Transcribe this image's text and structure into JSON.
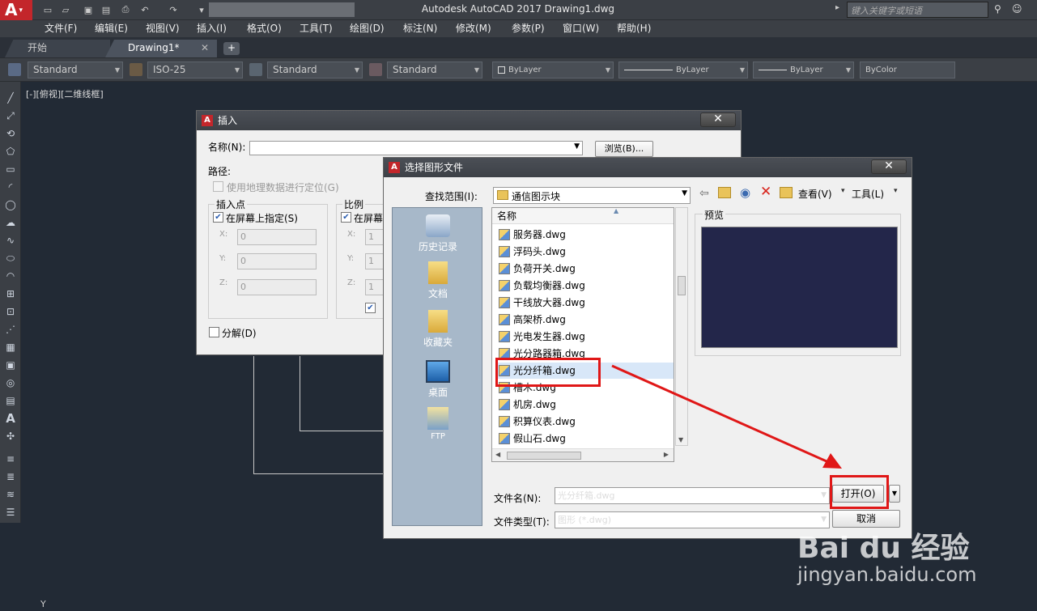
{
  "app": {
    "title": "Autodesk AutoCAD 2017    Drawing1.dwg",
    "search_placeholder": "键入关键字或短语"
  },
  "menu": [
    "文件(F)",
    "编辑(E)",
    "视图(V)",
    "插入(I)",
    "格式(O)",
    "工具(T)",
    "绘图(D)",
    "标注(N)",
    "修改(M)",
    "参数(P)",
    "窗口(W)",
    "帮助(H)"
  ],
  "tabs": {
    "start": "开始",
    "drawing": "Drawing1*",
    "add": "+"
  },
  "toolbar": {
    "text_style": "Standard",
    "dim_style": "ISO-25",
    "table_style": "Standard",
    "mleader_style": "Standard",
    "color": "ByLayer",
    "linetype": "ByLayer",
    "lineweight": "ByLayer",
    "plotstyle": "ByColor"
  },
  "viewport_label": "[-][俯视][二维线框]",
  "axis_label": "Y",
  "insert_dialog": {
    "title": "插入",
    "name_label": "名称(N):",
    "browse": "浏览(B)...",
    "path_label": "路径:",
    "geo_label": "使用地理数据进行定位(G)",
    "insertion_point": "插入点",
    "on_screen": "在屏幕上指定(S)",
    "x": "X:",
    "y": "Y:",
    "z": "Z:",
    "x_val": "0",
    "y_val": "0",
    "z_val": "0",
    "scale": "比例",
    "scale_on_screen": "在屏幕",
    "scale_val": "1",
    "explode": "分解(D)"
  },
  "file_dialog": {
    "title": "选择图形文件",
    "lookin_label": "查找范围(I):",
    "lookin_value": "通信图示块",
    "view_label": "查看(V)",
    "tools_label": "工具(L)",
    "preview_label": "预览",
    "column_name": "名称",
    "places": [
      "历史记录",
      "文档",
      "收藏夹",
      "桌面",
      "FTP"
    ],
    "files": [
      "服务器.dwg",
      "浮码头.dwg",
      "负荷开关.dwg",
      "负载均衡器.dwg",
      "干线放大器.dwg",
      "高架桥.dwg",
      "光电发生器.dwg",
      "光分路器箱.dwg",
      "光分纤箱.dwg",
      "槽木.dwg",
      "机房.dwg",
      "积算仪表.dwg",
      "假山石.dwg"
    ],
    "selected_file": "光分纤箱.dwg",
    "filename_label": "文件名(N):",
    "filename_value": "光分纤箱.dwg",
    "filetype_label": "文件类型(T):",
    "filetype_value": "图形 (*.dwg)",
    "open_button": "打开(O)",
    "cancel_button": "取消"
  },
  "watermark": {
    "brand": "Bai du 经验",
    "url": "jingyan.baidu.com"
  },
  "colors": {
    "accent": "#c3262b",
    "highlight": "#e01717",
    "canvas": "#222a35"
  }
}
